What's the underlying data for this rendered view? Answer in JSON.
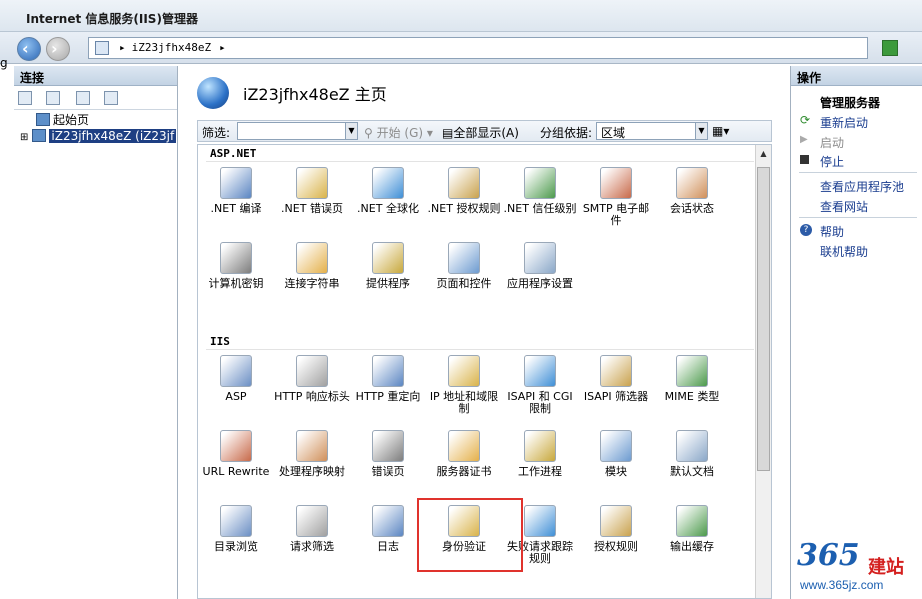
{
  "window": {
    "title": "Internet 信息服务(IIS)管理器"
  },
  "nav": {
    "address": "iZ23jfhx48eZ",
    "left_fragment": "g"
  },
  "left": {
    "header": "连接",
    "tree": {
      "start_page": "起始页",
      "server": "iZ23jfhx48eZ (iZ23jf"
    }
  },
  "center": {
    "title": "iZ23jfhx48eZ 主页",
    "filter": {
      "label": "筛选:",
      "start": "开始 (G)",
      "show_all": "全部显示(A)",
      "group_label": "分组依据:",
      "group_value": "区域"
    },
    "sections": [
      {
        "name": "ASP.NET",
        "items": [
          ".NET 编译",
          ".NET 错误页",
          ".NET 全球化",
          ".NET 授权规则",
          ".NET 信任级别",
          "SMTP 电子邮件",
          "会话状态",
          "计算机密钥",
          "连接字符串",
          "提供程序",
          "页面和控件",
          "应用程序设置"
        ]
      },
      {
        "name": "IIS",
        "items": [
          "ASP",
          "HTTP 响应标头",
          "HTTP 重定向",
          "IP 地址和域限制",
          "ISAPI 和 CGI 限制",
          "ISAPI 筛选器",
          "MIME 类型",
          "URL Rewrite",
          "处理程序映射",
          "错误页",
          "服务器证书",
          "工作进程",
          "模块",
          "默认文档",
          "目录浏览",
          "请求筛选",
          "日志",
          "身份验证",
          "失败请求跟踪规则",
          "授权规则",
          "输出缓存"
        ]
      }
    ]
  },
  "right": {
    "header": "操作",
    "group": "管理服务器",
    "restart": "重新启动",
    "start": "启动",
    "stop": "停止",
    "view_pools": "查看应用程序池",
    "view_sites": "查看网站",
    "help": "帮助",
    "online_help": "联机帮助"
  },
  "watermark": {
    "num": "365",
    "brand": "建站",
    "url": "www.365jz.com"
  }
}
